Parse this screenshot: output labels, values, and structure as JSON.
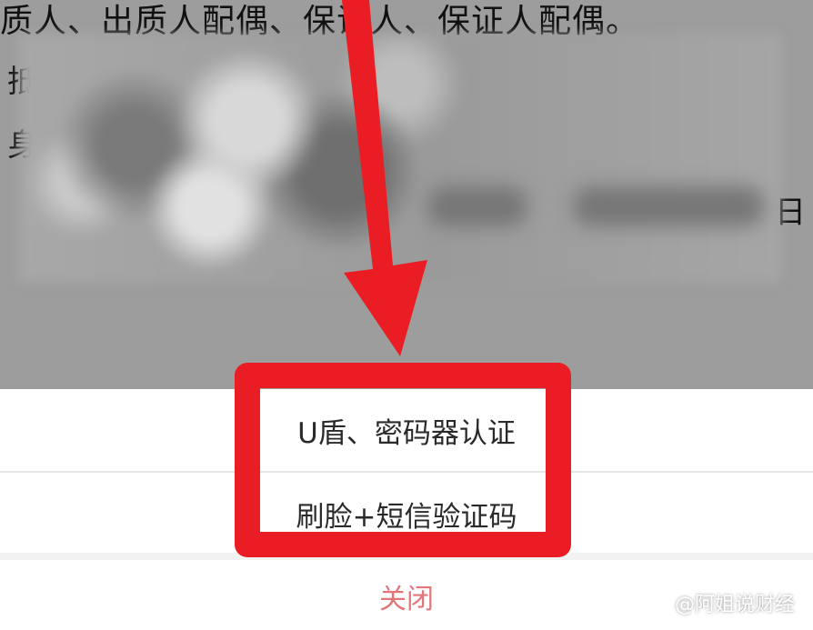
{
  "background": {
    "top_text": "质人、出质人配偶、保证人、保证人配偶。",
    "fragment_1": "抵",
    "fragment_2": "身",
    "fragment_3": "日"
  },
  "sheet": {
    "options": [
      "U盾、密码器认证",
      "刷脸+短信验证码"
    ],
    "close_label": "关闭"
  },
  "watermark": {
    "text": "@阿姐说财经"
  },
  "colors": {
    "annotation": "#ea1d24",
    "close_text": "#e3767a",
    "dim_overlay": "#9d9d9d"
  }
}
